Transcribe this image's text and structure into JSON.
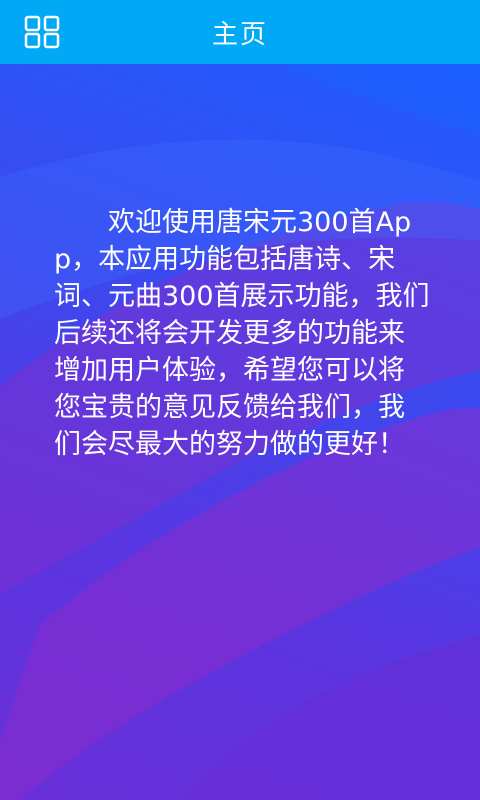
{
  "header": {
    "title": "主页",
    "menu_icon": "grid-menu-icon",
    "background_color": "#00a8f5"
  },
  "main": {
    "intro_text": "欢迎使用唐宋元300首App，本应用功能包括唐诗、宋词、元曲300首展示功能，我们后续还将会开发更多的功能来增加用户体验，希望您可以将您宝贵的意见反馈给我们，我们会尽最大的努力做的更好！"
  }
}
